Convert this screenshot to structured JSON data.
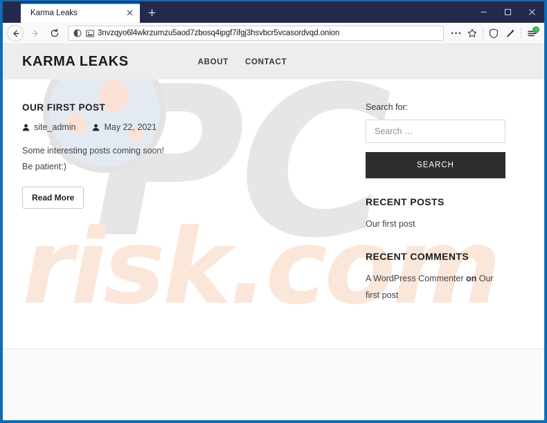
{
  "browser": {
    "tab": {
      "title": "Karma Leaks",
      "close_icon": "close-icon"
    },
    "new_tab_label": "+",
    "window_controls": {
      "minimize": "minimize-icon",
      "maximize": "maximize-icon",
      "close": "close-icon"
    },
    "nav": {
      "back": "back-arrow-icon",
      "forward": "forward-arrow-icon",
      "reload": "reload-icon"
    },
    "address": {
      "url": "3nvzqyo6l4wkrzumzu5aod7zbosq4ipgf7ifgj3hsvbcr5vcasordvqd.onion",
      "identity_icon": "onion-circle-icon",
      "reader_icon": "image-icon"
    },
    "toolbar": {
      "page_actions_icon": "ellipsis-icon",
      "bookmark_icon": "star-icon",
      "shield_icon": "shield-icon",
      "noscript_icon": "noscript-icon",
      "menu_icon": "hamburger-menu-icon",
      "update_badge": "↑"
    }
  },
  "site": {
    "title": "KARMA LEAKS",
    "nav": [
      {
        "label": "ABOUT"
      },
      {
        "label": "CONTACT"
      }
    ]
  },
  "post": {
    "title": "OUR FIRST POST",
    "author": "site_admin",
    "author_icon": "user-icon",
    "date": "May 22, 2021",
    "date_icon": "user-icon",
    "body_line1": "Some interesting posts coming soon!",
    "body_line2": "Be patient:)",
    "read_more": "Read More"
  },
  "sidebar": {
    "search": {
      "label": "Search for:",
      "placeholder": "Search …",
      "value": "",
      "button": "SEARCH"
    },
    "recent_posts": {
      "title": "RECENT POSTS",
      "items": [
        {
          "label": "Our first post"
        }
      ]
    },
    "recent_comments": {
      "title": "RECENT COMMENTS",
      "author": "A WordPress Commenter",
      "connector": "on",
      "target": "Our first post"
    }
  },
  "watermark": {
    "primary": "PC",
    "secondary": "risk.com"
  },
  "colors": {
    "window_border": "#0f6cb5",
    "titlebar": "#22294d",
    "tab_accent": "#0a84ff",
    "site_header": "#ededed",
    "search_button": "#2e2e2e",
    "update_badge": "#30b44a",
    "watermark_primary": "#e6e6e6",
    "watermark_secondary": "#fbe7da"
  }
}
